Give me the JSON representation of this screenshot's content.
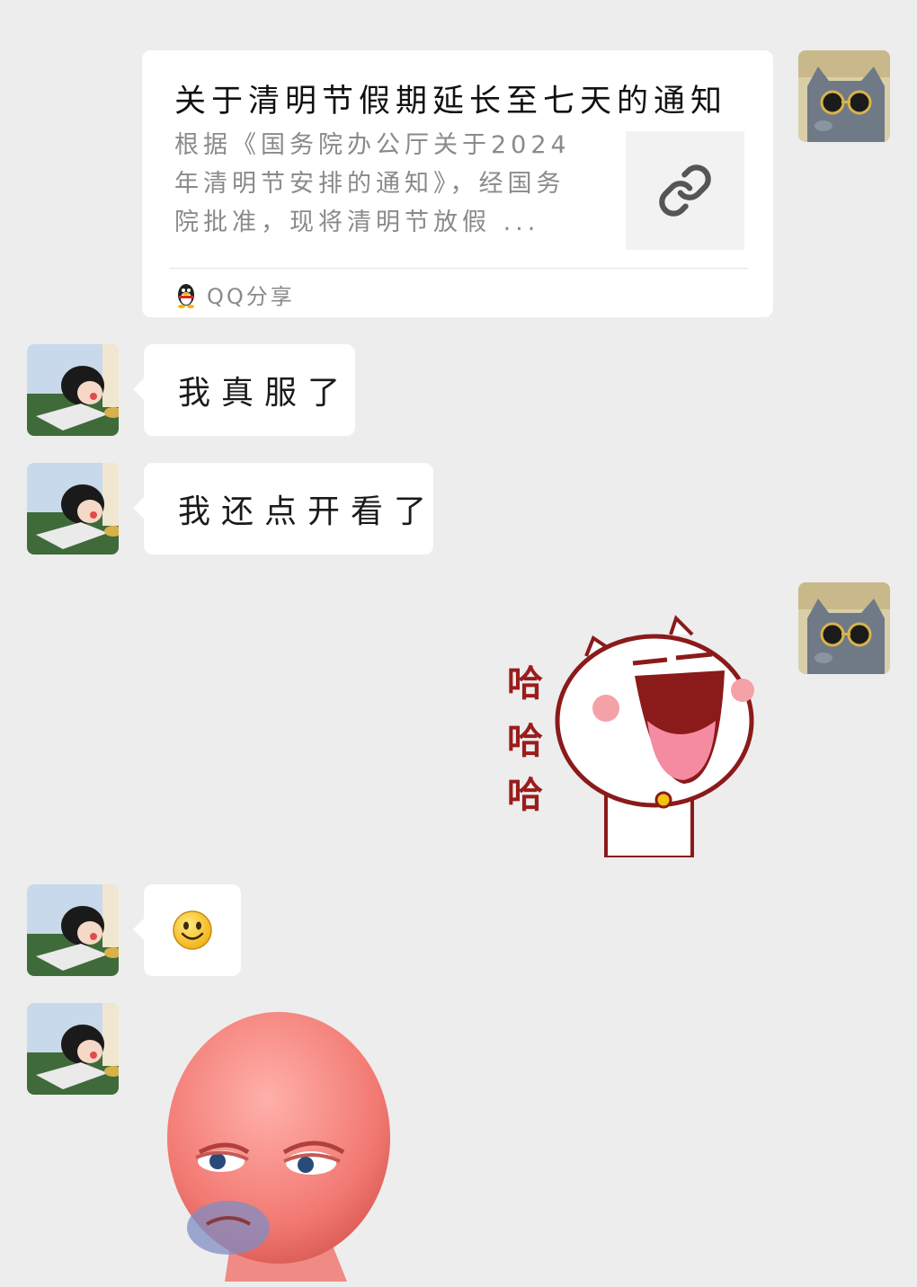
{
  "chat": {
    "link_card": {
      "title": "关于清明节假期延长至七天的通知",
      "description": "根据《国务院办公厅关于2024年清明节安排的通知》，经国务院批准，现将清明节放假 ...",
      "source": "QQ分享",
      "thumbnail_icon": "link-icon",
      "source_icon": "qq-penguin-icon"
    },
    "messages": [
      {
        "text": "我真服了"
      },
      {
        "text": "我还点开看了"
      }
    ],
    "laugh_sticker": {
      "caption_1": "哈",
      "caption_2": "哈",
      "caption_3": "哈"
    },
    "emoji_message": {
      "icon": "smile-emoji"
    },
    "face_sticker": {
      "icon": "pink-grumpy-face-sticker"
    }
  },
  "colors": {
    "background": "#ededed",
    "bubble": "#ffffff",
    "muted_text": "#8a8a8a",
    "sticker_red": "#9b1c1c"
  }
}
